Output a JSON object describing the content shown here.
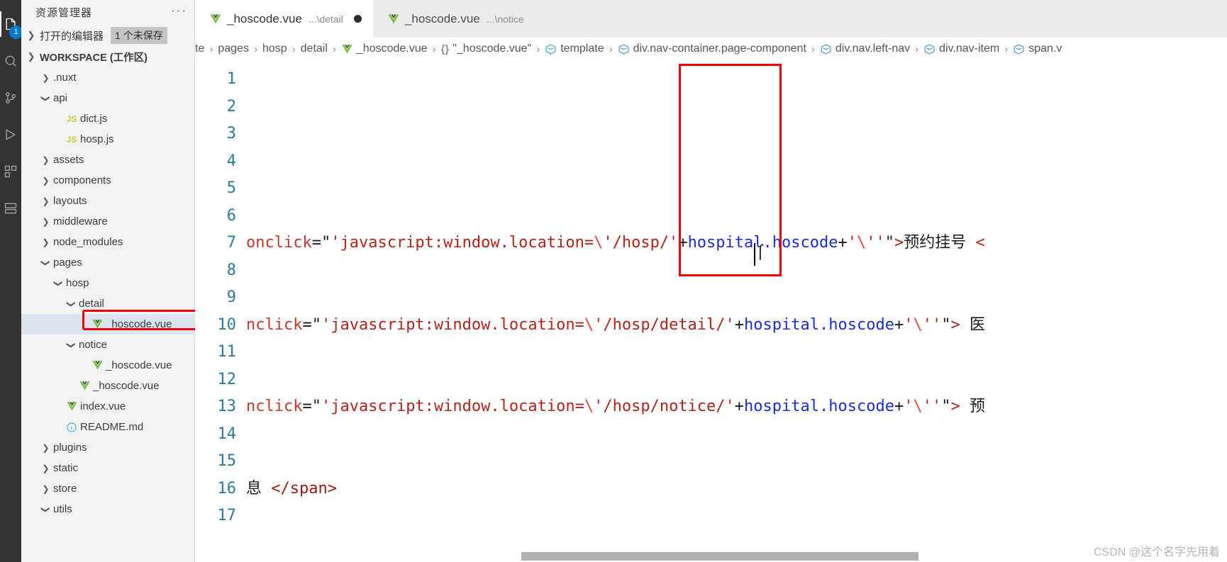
{
  "activity_bar": {
    "items": [
      {
        "name": "explorer-icon",
        "badge": "1"
      },
      {
        "name": "search-icon",
        "badge": ""
      },
      {
        "name": "source-control-icon",
        "badge": ""
      },
      {
        "name": "run-debug-icon",
        "badge": ""
      },
      {
        "name": "extensions-icon",
        "badge": ""
      },
      {
        "name": "remote-explorer-icon",
        "badge": ""
      }
    ]
  },
  "sidebar": {
    "title": "资源管理器",
    "more_actions": "···",
    "open_editors": {
      "label": "打开的编辑器",
      "badge": "1 个未保存"
    },
    "workspace": {
      "label": "WORKSPACE (工作区)"
    },
    "tree": [
      {
        "label": ".nuxt",
        "indent": 1,
        "twisty": ">",
        "icon": "folder",
        "selected": false
      },
      {
        "label": "api",
        "indent": 1,
        "twisty": "v",
        "icon": "folder",
        "selected": false
      },
      {
        "label": "dict.js",
        "indent": 2,
        "twisty": "",
        "icon": "js",
        "selected": false
      },
      {
        "label": "hosp.js",
        "indent": 2,
        "twisty": "",
        "icon": "js",
        "selected": false
      },
      {
        "label": "assets",
        "indent": 1,
        "twisty": ">",
        "icon": "folder",
        "selected": false
      },
      {
        "label": "components",
        "indent": 1,
        "twisty": ">",
        "icon": "folder",
        "selected": false
      },
      {
        "label": "layouts",
        "indent": 1,
        "twisty": ">",
        "icon": "folder",
        "selected": false
      },
      {
        "label": "middleware",
        "indent": 1,
        "twisty": ">",
        "icon": "folder",
        "selected": false
      },
      {
        "label": "node_modules",
        "indent": 1,
        "twisty": ">",
        "icon": "folder",
        "selected": false
      },
      {
        "label": "pages",
        "indent": 1,
        "twisty": "v",
        "icon": "folder",
        "selected": false
      },
      {
        "label": "hosp",
        "indent": 2,
        "twisty": "v",
        "icon": "folder",
        "selected": false
      },
      {
        "label": "detail",
        "indent": 3,
        "twisty": "v",
        "icon": "folder",
        "selected": false
      },
      {
        "label": "_hoscode.vue",
        "indent": 4,
        "twisty": "",
        "icon": "vue",
        "selected": true
      },
      {
        "label": "notice",
        "indent": 3,
        "twisty": "v",
        "icon": "folder",
        "selected": false
      },
      {
        "label": "_hoscode.vue",
        "indent": 4,
        "twisty": "",
        "icon": "vue",
        "selected": false
      },
      {
        "label": "_hoscode.vue",
        "indent": 3,
        "twisty": "",
        "icon": "vue",
        "selected": false
      },
      {
        "label": "index.vue",
        "indent": 2,
        "twisty": "",
        "icon": "vue",
        "selected": false
      },
      {
        "label": "README.md",
        "indent": 2,
        "twisty": "",
        "icon": "md",
        "selected": false
      },
      {
        "label": "plugins",
        "indent": 1,
        "twisty": ">",
        "icon": "folder",
        "selected": false
      },
      {
        "label": "static",
        "indent": 1,
        "twisty": ">",
        "icon": "folder",
        "selected": false
      },
      {
        "label": "store",
        "indent": 1,
        "twisty": ">",
        "icon": "folder",
        "selected": false
      },
      {
        "label": "utils",
        "indent": 1,
        "twisty": "v",
        "icon": "folder",
        "selected": false
      }
    ]
  },
  "tabs": [
    {
      "name": "_hoscode.vue",
      "path": "...\\detail",
      "dirty": true,
      "active": true
    },
    {
      "name": "_hoscode.vue",
      "path": "...\\notice",
      "dirty": false,
      "active": false
    }
  ],
  "breadcrumb": [
    {
      "label": "te",
      "icon": "none"
    },
    {
      "label": "pages",
      "icon": "none"
    },
    {
      "label": "hosp",
      "icon": "none"
    },
    {
      "label": "detail",
      "icon": "none"
    },
    {
      "label": "_hoscode.vue",
      "icon": "vue"
    },
    {
      "label": "\"_hoscode.vue\"",
      "icon": "braces"
    },
    {
      "label": "template",
      "icon": "symbol"
    },
    {
      "label": "div.nav-container.page-component",
      "icon": "symbol"
    },
    {
      "label": "div.nav.left-nav",
      "icon": "symbol"
    },
    {
      "label": "div.nav-item",
      "icon": "symbol"
    },
    {
      "label": "span.v",
      "icon": "symbol"
    }
  ],
  "editor": {
    "line_numbers": [
      "1",
      "2",
      "3",
      "4",
      "5",
      "6",
      "7",
      "8",
      "9",
      "10",
      "11",
      "12",
      "13",
      "14",
      "15",
      "16",
      "17"
    ],
    "lines": [
      {
        "n": "1",
        "tokens": []
      },
      {
        "n": "2",
        "tokens": []
      },
      {
        "n": "3",
        "tokens": []
      },
      {
        "n": "4",
        "tokens": []
      },
      {
        "n": "5",
        "tokens": []
      },
      {
        "n": "6",
        "tokens": []
      },
      {
        "n": "7",
        "tokens": [
          {
            "t": "onclick",
            "c": "tk-attr"
          },
          {
            "t": "=",
            "c": "tk-punct"
          },
          {
            "t": "\"",
            "c": "tk-punct"
          },
          {
            "t": "'javascript:window.location=",
            "c": "tk-str"
          },
          {
            "t": "\\",
            "c": "tk-esc"
          },
          {
            "t": "'/hosp/'",
            "c": "tk-str"
          },
          {
            "t": "+",
            "c": "tk-punct"
          },
          {
            "t": "hospital.hoscode",
            "c": "tk-expr"
          },
          {
            "t": "+",
            "c": "tk-punct"
          },
          {
            "t": "'",
            "c": "tk-str"
          },
          {
            "t": "\\",
            "c": "tk-esc"
          },
          {
            "t": "'",
            "c": "tk-str"
          },
          {
            "t": "'",
            "c": "tk-str"
          },
          {
            "t": "\"",
            "c": "tk-punct"
          },
          {
            "t": ">",
            "c": "tk-angle"
          },
          {
            "t": "预约挂号",
            "c": "tk-txt"
          },
          {
            "t": " <",
            "c": "tk-angle"
          }
        ]
      },
      {
        "n": "8",
        "tokens": []
      },
      {
        "n": "9",
        "tokens": []
      },
      {
        "n": "10",
        "tokens": [
          {
            "t": "nclick",
            "c": "tk-attr"
          },
          {
            "t": "=",
            "c": "tk-punct"
          },
          {
            "t": "\"",
            "c": "tk-punct"
          },
          {
            "t": "'javascript:window.location=",
            "c": "tk-str"
          },
          {
            "t": "\\",
            "c": "tk-esc"
          },
          {
            "t": "'/hosp/detail/'",
            "c": "tk-str"
          },
          {
            "t": "+",
            "c": "tk-punct"
          },
          {
            "t": "hospital.hoscode",
            "c": "tk-expr"
          },
          {
            "t": "+",
            "c": "tk-punct"
          },
          {
            "t": "'",
            "c": "tk-str"
          },
          {
            "t": "\\",
            "c": "tk-esc"
          },
          {
            "t": "'",
            "c": "tk-str"
          },
          {
            "t": "'",
            "c": "tk-str"
          },
          {
            "t": "\"",
            "c": "tk-punct"
          },
          {
            "t": ">",
            "c": "tk-angle"
          },
          {
            "t": " 医",
            "c": "tk-txt"
          }
        ]
      },
      {
        "n": "11",
        "tokens": []
      },
      {
        "n": "12",
        "tokens": []
      },
      {
        "n": "13",
        "tokens": [
          {
            "t": "nclick",
            "c": "tk-attr"
          },
          {
            "t": "=",
            "c": "tk-punct"
          },
          {
            "t": "\"",
            "c": "tk-punct"
          },
          {
            "t": "'javascript:window.location=",
            "c": "tk-str"
          },
          {
            "t": "\\",
            "c": "tk-esc"
          },
          {
            "t": "'/hosp/notice/'",
            "c": "tk-str"
          },
          {
            "t": "+",
            "c": "tk-punct"
          },
          {
            "t": "hospital.hoscode",
            "c": "tk-expr"
          },
          {
            "t": "+",
            "c": "tk-punct"
          },
          {
            "t": "'",
            "c": "tk-str"
          },
          {
            "t": "\\",
            "c": "tk-esc"
          },
          {
            "t": "'",
            "c": "tk-str"
          },
          {
            "t": "'",
            "c": "tk-str"
          },
          {
            "t": "\"",
            "c": "tk-punct"
          },
          {
            "t": ">",
            "c": "tk-angle"
          },
          {
            "t": " 预",
            "c": "tk-txt"
          }
        ]
      },
      {
        "n": "14",
        "tokens": []
      },
      {
        "n": "15",
        "tokens": []
      },
      {
        "n": "16",
        "tokens": [
          {
            "t": "息 ",
            "c": "tk-txt"
          },
          {
            "t": "</span>",
            "c": "tk-tag"
          }
        ]
      },
      {
        "n": "17",
        "tokens": []
      }
    ]
  },
  "watermark": "CSDN @这个名字先用着",
  "colors": {
    "accent": "#007acc",
    "highlight_box": "#f00000",
    "activity_bar_bg": "#333333",
    "sidebar_bg": "#f3f3f3",
    "tab_bar_bg": "#ececec",
    "selected_row_bg": "#dbe3f0",
    "line_number": "#2b7a99"
  }
}
